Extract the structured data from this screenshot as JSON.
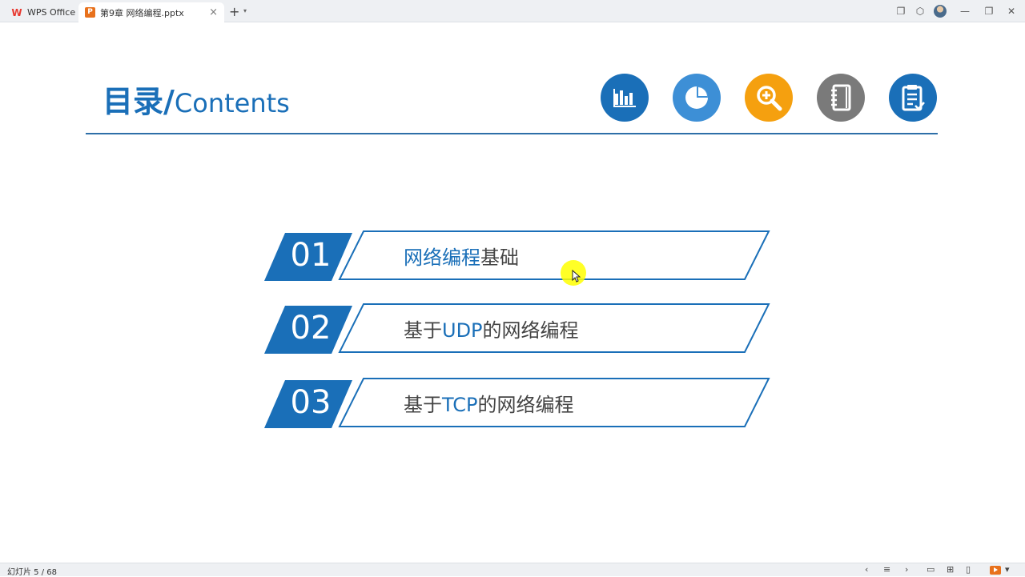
{
  "window": {
    "home_tab": "WPS Office",
    "doc_tab": "第9章 网络编程.pptx",
    "new_tab": "+"
  },
  "slide": {
    "title_cn": "目录/",
    "title_en": "Contents",
    "icons": [
      "bar-chart-icon",
      "pie-chart-icon",
      "zoom-in-icon",
      "notebook-icon",
      "clipboard-check-icon"
    ],
    "icon_colors": [
      "#1a6fb8",
      "#3d8fd6",
      "#f5a00f",
      "#7a7a7a",
      "#1a6fb8"
    ],
    "items": [
      {
        "num": "01",
        "hl": "网络编程",
        "rest": "基础"
      },
      {
        "num": "02",
        "pre": "基于",
        "hl": "UDP",
        "rest": "的网络编程"
      },
      {
        "num": "03",
        "pre": "基于",
        "hl": "TCP",
        "rest": "的网络编程"
      }
    ],
    "accent": "#1a6fb8"
  },
  "status": {
    "slide_count": "幻灯片 5 / 68"
  }
}
